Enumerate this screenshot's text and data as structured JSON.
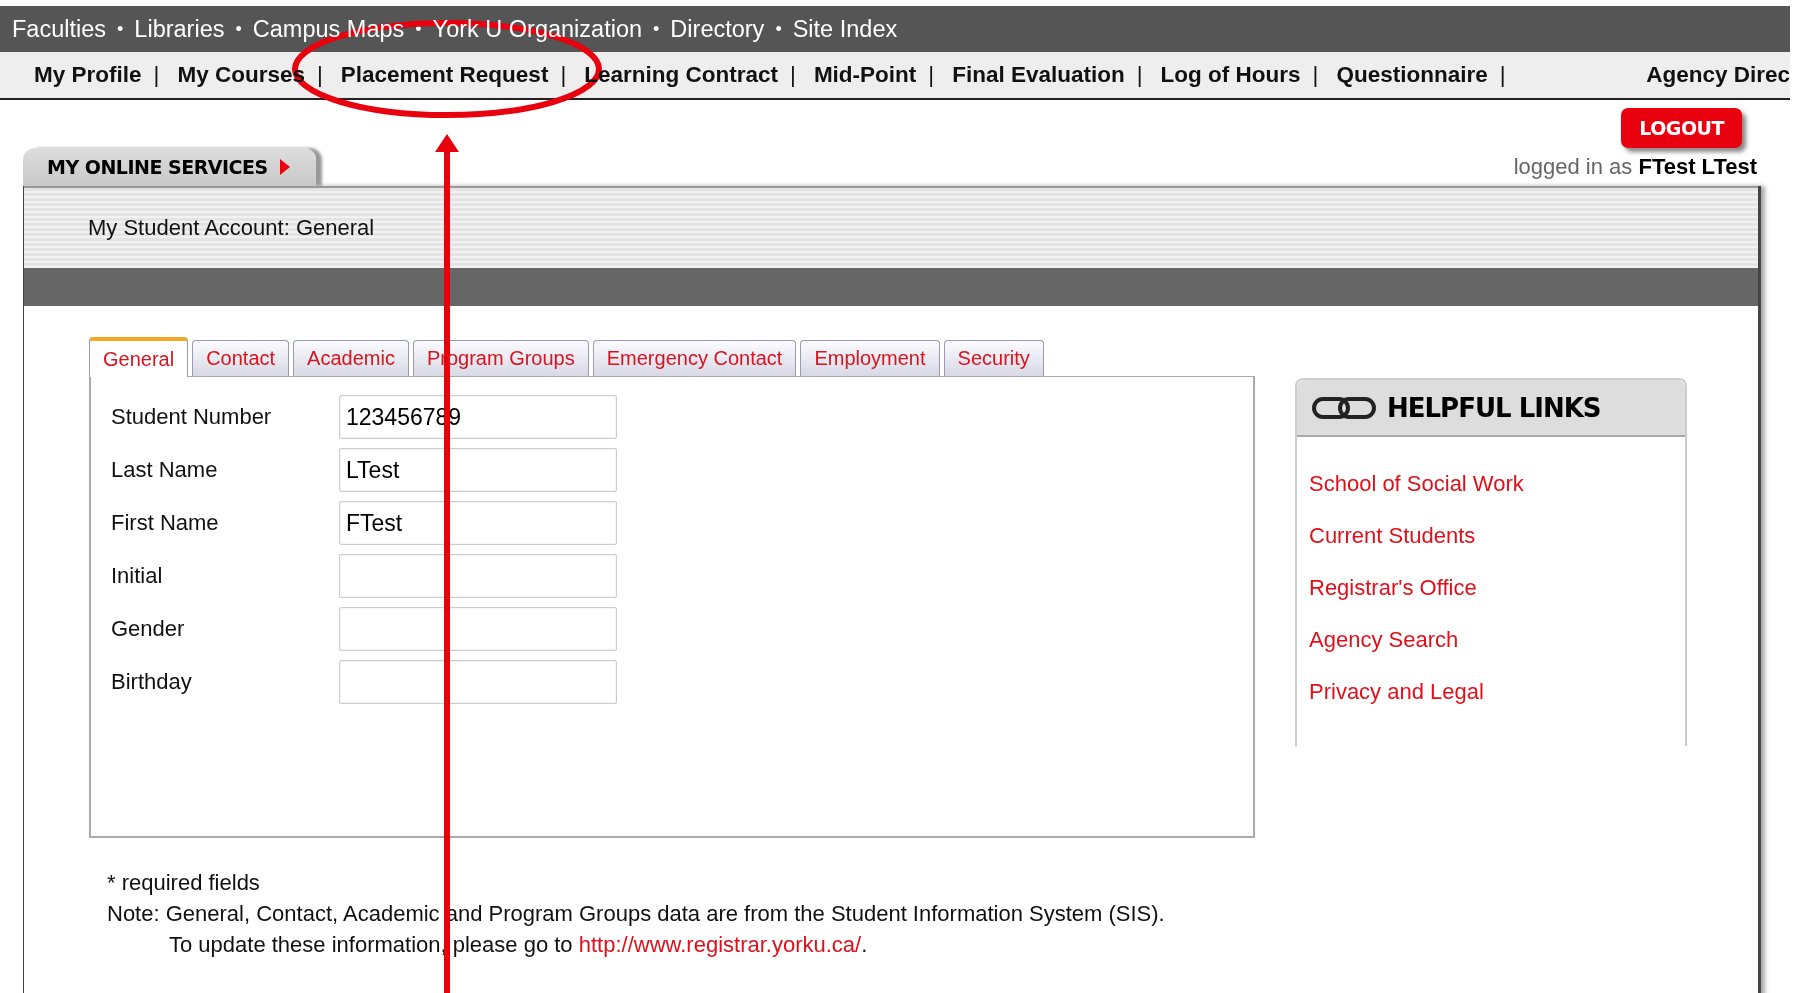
{
  "top_links": [
    {
      "label": "Faculties",
      "separator": "•"
    },
    {
      "label": "Libraries",
      "separator": "•"
    },
    {
      "label": "Campus Maps",
      "separator": "•"
    },
    {
      "label": "York U Organization",
      "separator": "•"
    },
    {
      "label": "Directory",
      "separator": "•"
    },
    {
      "label": "Site Index"
    }
  ],
  "nav_links": [
    {
      "label": "My Profile",
      "separator": "|"
    },
    {
      "label": "My Courses",
      "separator": "|"
    },
    {
      "label": "Placement Request",
      "separator": "|"
    },
    {
      "label": "Learning Contract",
      "separator": "|"
    },
    {
      "label": "Mid-Point",
      "separator": "|"
    },
    {
      "label": "Final Evaluation",
      "separator": "|"
    },
    {
      "label": "Log of Hours",
      "separator": "|"
    },
    {
      "label": "Questionnaire",
      "separator": "|"
    }
  ],
  "nav_right": "Agency Direc",
  "logout": "LOGOUT",
  "services_tab": "MY ONLINE SERVICES",
  "logged_in": {
    "prefix": "logged in as",
    "user": "FTest LTest"
  },
  "page_title": "My Student Account: General",
  "tabs": [
    {
      "label": "General",
      "selected": true
    },
    {
      "label": "Contact",
      "selected": false
    },
    {
      "label": "Academic",
      "selected": false
    },
    {
      "label": "Program Groups",
      "selected": false
    },
    {
      "label": "Emergency Contact",
      "selected": false
    },
    {
      "label": "Employment",
      "selected": false
    },
    {
      "label": "Security",
      "selected": false
    }
  ],
  "fields": [
    {
      "label": "Student Number",
      "value": "123456789"
    },
    {
      "label": "Last Name",
      "value": "LTest"
    },
    {
      "label": "First Name",
      "value": "FTest"
    },
    {
      "label": "Initial"
    },
    {
      "label": "Gender"
    },
    {
      "label": "Birthday"
    }
  ],
  "helpful_links": {
    "title": "HELPFUL LINKS",
    "links": [
      "School of Social Work",
      "Current Students",
      "Registrar's Office",
      "Agency Search",
      "Privacy and Legal"
    ]
  },
  "notes": {
    "required": "* required fields",
    "note": "Note: General, Contact, Academic and Program Groups data are from the Student Information System (SIS).",
    "update": "To update these information, please go to",
    "url": "http://www.registrar.yorku.ca/",
    "end": "."
  }
}
